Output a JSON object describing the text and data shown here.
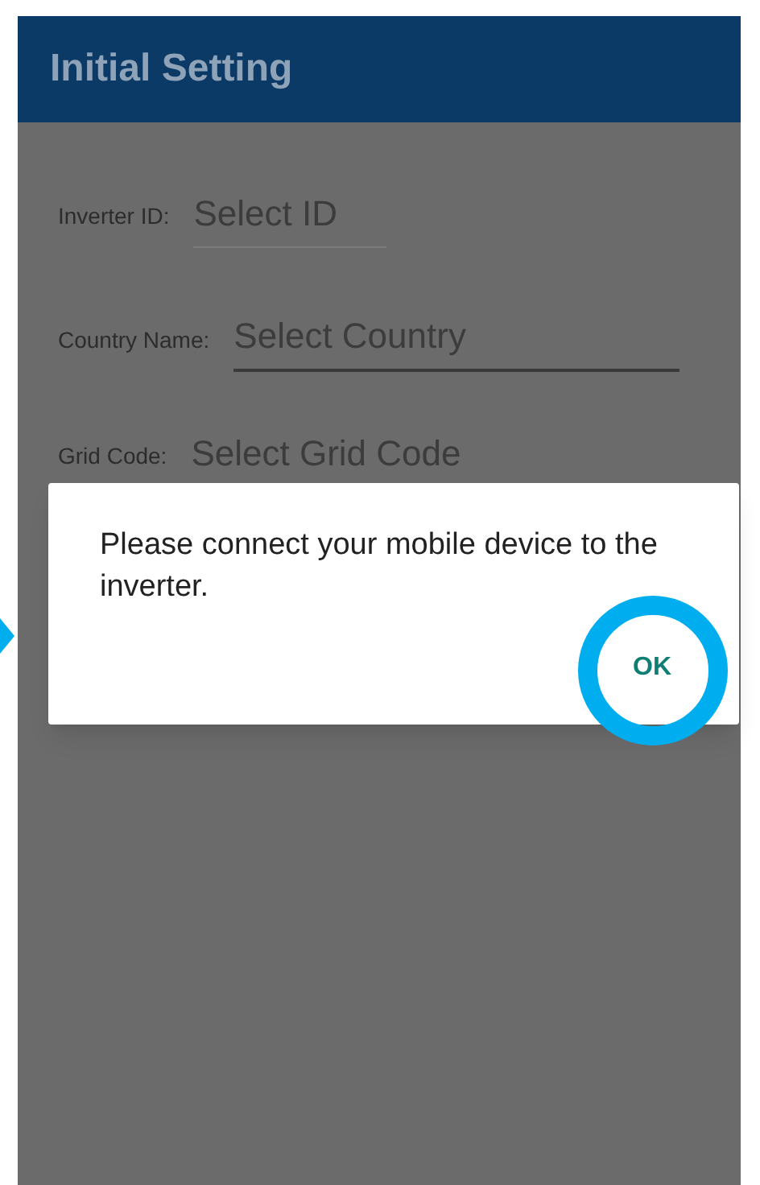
{
  "app_bar": {
    "title": "Initial Setting"
  },
  "form": {
    "fields": [
      {
        "label": "Inverter ID:",
        "placeholder": "Select ID",
        "focused": false
      },
      {
        "label": "Country Name:",
        "placeholder": "Select Country",
        "focused": true
      },
      {
        "label": "Grid Code:",
        "placeholder": "Select Grid Code",
        "focused": false
      }
    ]
  },
  "dialog": {
    "message": "Please connect your mobile device to the inverter.",
    "button": "OK",
    "highlighted": true
  }
}
